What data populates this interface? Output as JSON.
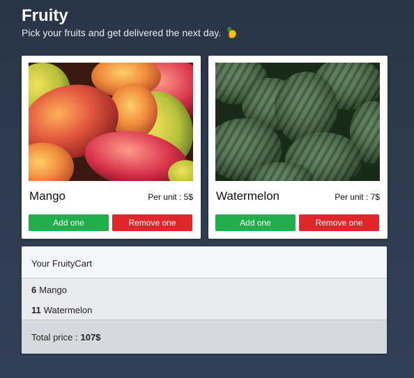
{
  "app": {
    "title": "Fruity",
    "subtitle": "Pick your fruits and get delivered the next day."
  },
  "products": [
    {
      "name": "Mango",
      "price_label": "Per unit : 5$",
      "add_label": "Add one",
      "remove_label": "Remove one"
    },
    {
      "name": "Watermelon",
      "price_label": "Per unit : 7$",
      "add_label": "Add one",
      "remove_label": "Remove one"
    }
  ],
  "cart": {
    "title": "Your FruityCart",
    "items": [
      {
        "qty": "6",
        "name": "Mango"
      },
      {
        "qty": "11",
        "name": "Watermelon"
      }
    ],
    "total_label": "Total price :",
    "total_value": "107$"
  },
  "colors": {
    "add": "#20ad4c",
    "remove": "#e0262b",
    "background": "#2a3547"
  }
}
